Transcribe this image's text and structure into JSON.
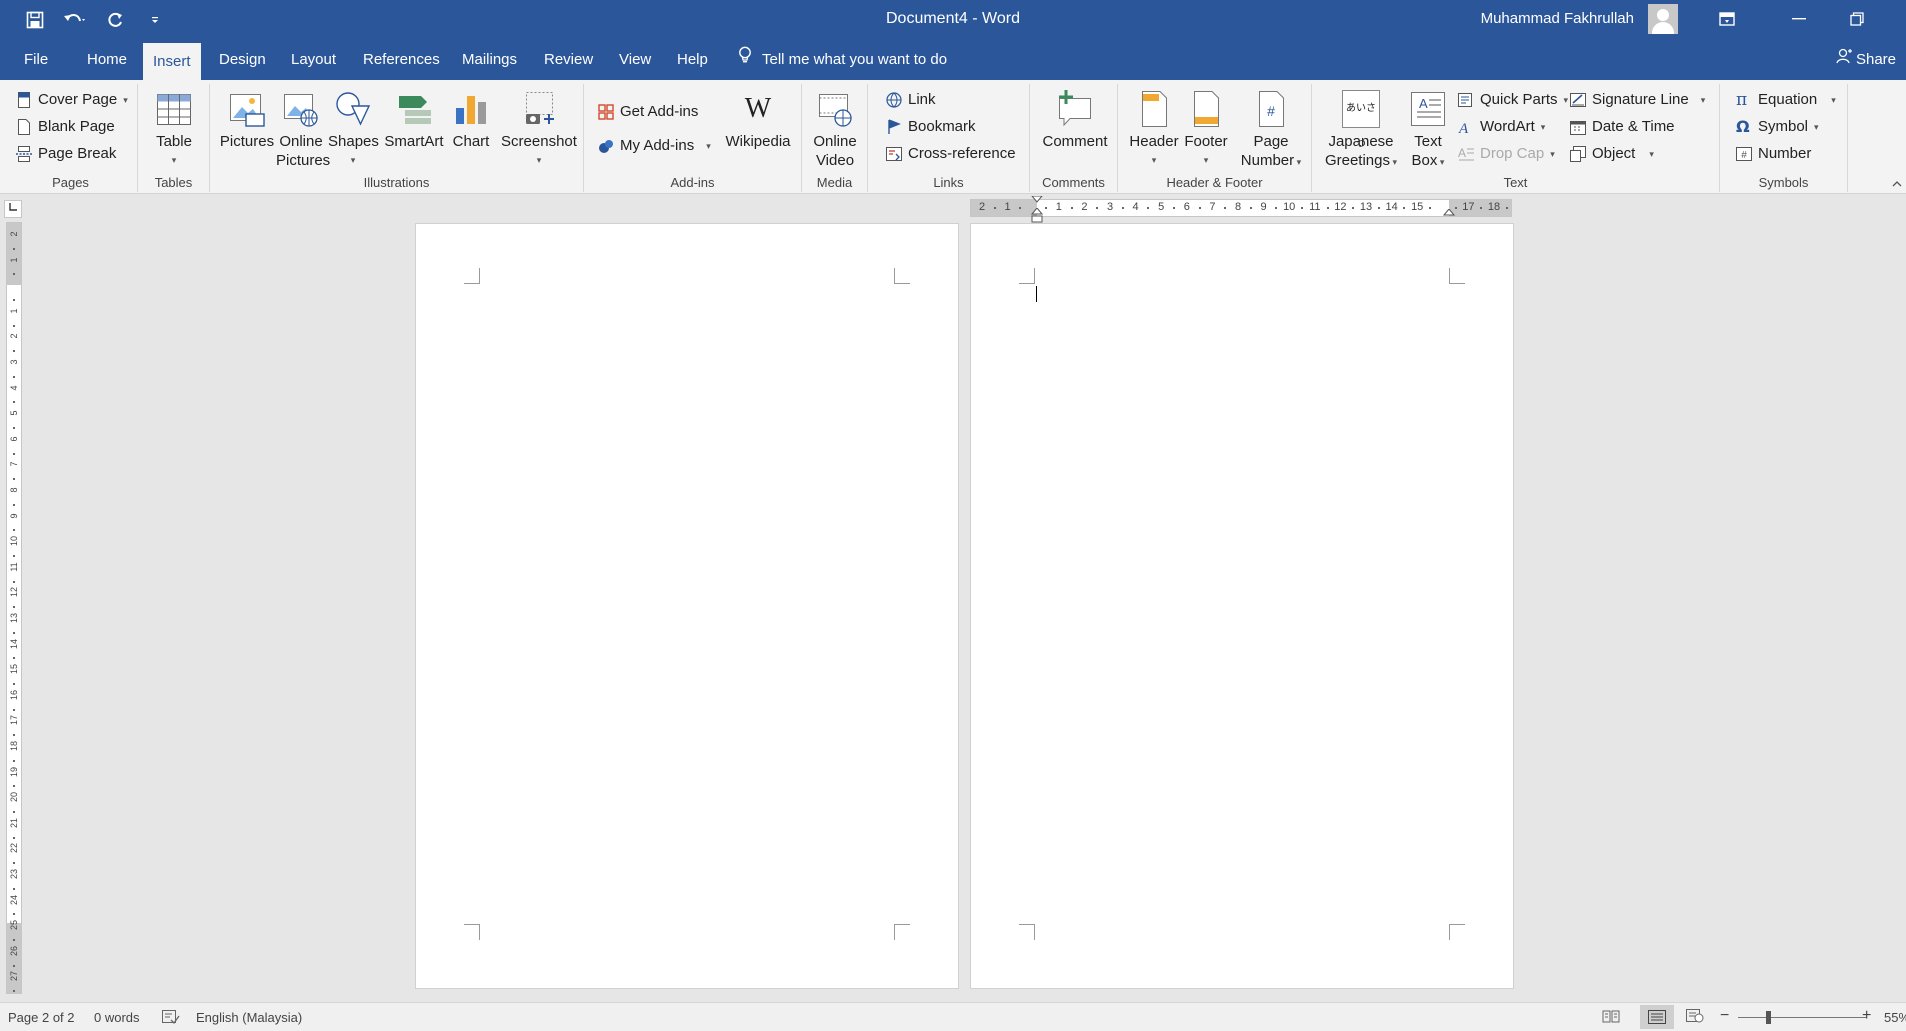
{
  "titlebar": {
    "doc_title": "Document4 - Word",
    "user_name": "Muhammad Fakhrullah",
    "qat": [
      "save-icon",
      "undo-icon",
      "redo-icon",
      "customize-icon"
    ]
  },
  "tabs": {
    "file": "File",
    "home": "Home",
    "insert": "Insert",
    "design": "Design",
    "layout": "Layout",
    "references": "References",
    "mailings": "Mailings",
    "review": "Review",
    "view": "View",
    "help": "Help",
    "tell_me": "Tell me what you want to do",
    "share": "Share"
  },
  "ribbon": {
    "pages": {
      "label": "Pages",
      "cover_page": "Cover Page",
      "blank_page": "Blank Page",
      "page_break": "Page Break"
    },
    "tables": {
      "label": "Tables",
      "table": "Table"
    },
    "illustrations": {
      "label": "Illustrations",
      "pictures": "Pictures",
      "online_pictures_1": "Online",
      "online_pictures_2": "Pictures",
      "shapes": "Shapes",
      "smartart": "SmartArt",
      "chart": "Chart",
      "screenshot": "Screenshot"
    },
    "addins": {
      "label": "Add-ins",
      "get_addins": "Get Add-ins",
      "my_addins": "My Add-ins",
      "wikipedia": "Wikipedia",
      "wikipedia_glyph": "W"
    },
    "media": {
      "label": "Media",
      "online_video_1": "Online",
      "online_video_2": "Video"
    },
    "links": {
      "label": "Links",
      "link": "Link",
      "bookmark": "Bookmark",
      "cross_reference": "Cross-reference"
    },
    "comments": {
      "label": "Comments",
      "comment": "Comment"
    },
    "header_footer": {
      "label": "Header & Footer",
      "header": "Header",
      "footer": "Footer",
      "page_number_1": "Page",
      "page_number_2": "Number"
    },
    "text": {
      "label": "Text",
      "japanese_1": "Japanese",
      "japanese_2": "Greetings",
      "japanese_glyph": "あいさつ",
      "text_box_1": "Text",
      "text_box_2": "Box",
      "quick_parts": "Quick Parts",
      "wordart": "WordArt",
      "drop_cap": "Drop Cap",
      "signature_line": "Signature Line",
      "date_time": "Date & Time",
      "object": "Object"
    },
    "symbols": {
      "label": "Symbols",
      "equation": "Equation",
      "symbol": "Symbol",
      "number": "Number"
    }
  },
  "ruler": {
    "ticks": [
      "2",
      "1",
      "",
      "1",
      "2",
      "3",
      "4",
      "5",
      "6",
      "7",
      "8",
      "9",
      "10",
      "11",
      "12",
      "13",
      "14",
      "15",
      "",
      "17",
      "18"
    ],
    "vticks": [
      "2",
      "1",
      "",
      "1",
      "2",
      "3",
      "4",
      "5",
      "6",
      "7",
      "8",
      "9",
      "10",
      "11",
      "12",
      "13",
      "14",
      "15",
      "16",
      "17",
      "18",
      "19",
      "20",
      "21",
      "22",
      "23",
      "24",
      "25",
      "26",
      "27"
    ]
  },
  "status": {
    "page": "Page 2 of 2",
    "words": "0 words",
    "language": "English (Malaysia)",
    "zoom": "55%"
  }
}
